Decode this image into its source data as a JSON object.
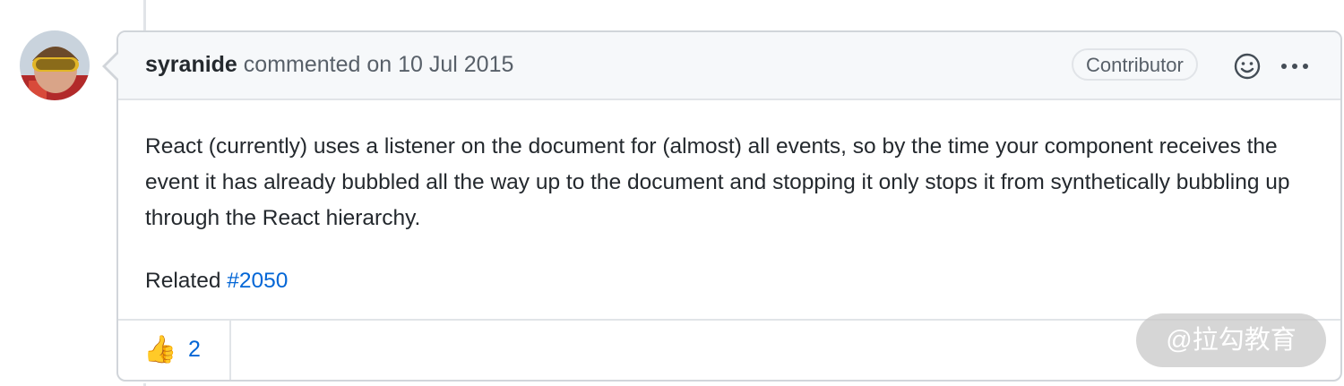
{
  "comment": {
    "author": "syranide",
    "action_text": "commented on 10 Jul 2015",
    "badge": "Contributor",
    "body_paragraph": "React (currently) uses a listener on the document for (almost) all events, so by the time your component receives the event it has already bubbled all the way up to the document and stopping it only stops it from synthetically bubbling up through the React hierarchy.",
    "related_label": "Related",
    "related_link": "#2050"
  },
  "reactions": [
    {
      "icon": "thumbs-up-icon",
      "glyph": "👍",
      "count": "2"
    }
  ],
  "watermark": "@拉勾教育"
}
